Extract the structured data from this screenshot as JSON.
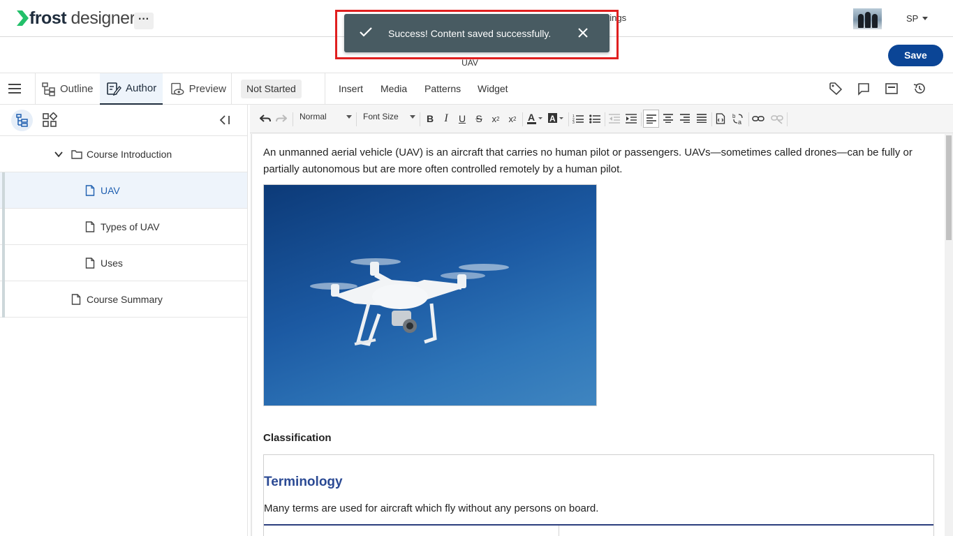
{
  "header": {
    "logo_bold": "frost",
    "logo_light": " designer",
    "more_label": "···",
    "settings_partial": "ttings",
    "user_initials": "SP"
  },
  "subheader": {
    "page_name": "UAV",
    "save_label": "Save"
  },
  "toast": {
    "message": "Success! Content saved successfully."
  },
  "modebar": {
    "tabs": [
      {
        "label": "Outline",
        "icon": "outline-icon"
      },
      {
        "label": "Author",
        "icon": "author-icon",
        "active": true
      },
      {
        "label": "Preview",
        "icon": "preview-icon"
      }
    ],
    "status": "Not Started",
    "menus": [
      "Insert",
      "Media",
      "Patterns",
      "Widget"
    ],
    "right_icons": [
      "tag-icon",
      "comment-icon",
      "layout-icon",
      "history-icon"
    ]
  },
  "tree": {
    "items": [
      {
        "label": "Course Introduction",
        "type": "folder",
        "expanded": true
      },
      {
        "label": "UAV",
        "type": "page",
        "selected": true
      },
      {
        "label": "Types of UAV",
        "type": "page"
      },
      {
        "label": "Uses",
        "type": "page"
      },
      {
        "label": "Course Summary",
        "type": "page"
      }
    ]
  },
  "editor_toolbar": {
    "style_select": "Normal",
    "size_select": "Font Size"
  },
  "document": {
    "intro": "An unmanned aerial vehicle (UAV) is an aircraft that carries no human pilot or passengers. UAVs—sometimes called drones—can be fully or partially autonomous but are more often controlled remotely by a human pilot.",
    "section_heading": "Classification",
    "box_title": "Terminology",
    "box_text": "Many terms are used for aircraft which fly without any persons on board."
  },
  "colors": {
    "primary": "#0b4596",
    "toast_bg": "#485b62",
    "highlight_frame": "#e01f1f",
    "link": "#2b4a94"
  }
}
